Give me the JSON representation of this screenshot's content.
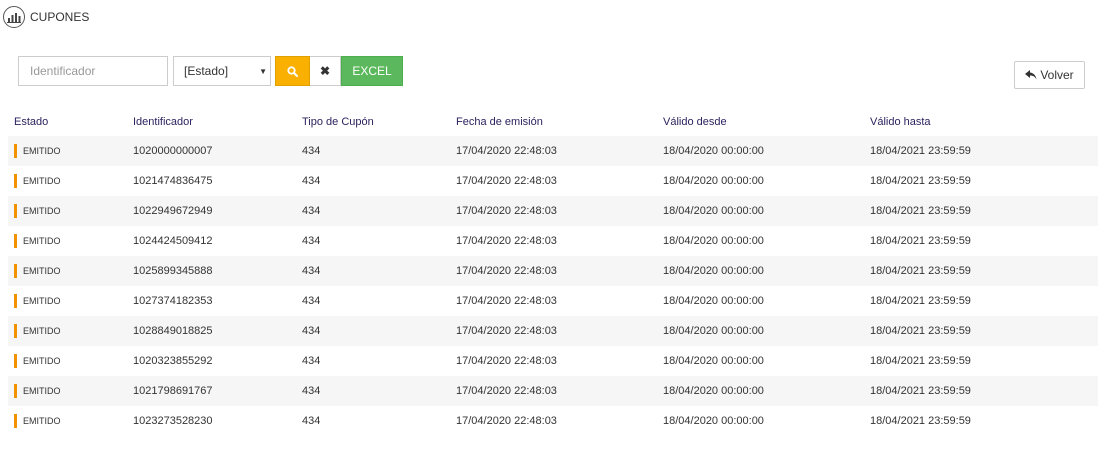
{
  "header": {
    "title": "CUPONES",
    "icon": "bar-chart-icon"
  },
  "filters": {
    "identifier_placeholder": "Identificador",
    "identifier_value": "",
    "state_selected": "[Estado]",
    "search_icon": "search-icon",
    "clear_icon": "close-icon",
    "excel_label": "EXCEL"
  },
  "back_button": {
    "label": "Volver",
    "icon": "reply-arrow-icon"
  },
  "colors": {
    "accent_orange": "#f9b000",
    "excel_green": "#5cb85c",
    "state_bar": "#f39200",
    "header_text": "#2a1f5c"
  },
  "table": {
    "columns": [
      "Estado",
      "Identificador",
      "Tipo de Cupón",
      "Fecha de emisión",
      "Válido desde",
      "Válido hasta"
    ],
    "rows": [
      {
        "estado": "EMITIDO",
        "identificador": "1020000000007",
        "tipo": "434",
        "emision": "17/04/2020 22:48:03",
        "desde": "18/04/2020 00:00:00",
        "hasta": "18/04/2021 23:59:59"
      },
      {
        "estado": "EMITIDO",
        "identificador": "1021474836475",
        "tipo": "434",
        "emision": "17/04/2020 22:48:03",
        "desde": "18/04/2020 00:00:00",
        "hasta": "18/04/2021 23:59:59"
      },
      {
        "estado": "EMITIDO",
        "identificador": "1022949672949",
        "tipo": "434",
        "emision": "17/04/2020 22:48:03",
        "desde": "18/04/2020 00:00:00",
        "hasta": "18/04/2021 23:59:59"
      },
      {
        "estado": "EMITIDO",
        "identificador": "1024424509412",
        "tipo": "434",
        "emision": "17/04/2020 22:48:03",
        "desde": "18/04/2020 00:00:00",
        "hasta": "18/04/2021 23:59:59"
      },
      {
        "estado": "EMITIDO",
        "identificador": "1025899345888",
        "tipo": "434",
        "emision": "17/04/2020 22:48:03",
        "desde": "18/04/2020 00:00:00",
        "hasta": "18/04/2021 23:59:59"
      },
      {
        "estado": "EMITIDO",
        "identificador": "1027374182353",
        "tipo": "434",
        "emision": "17/04/2020 22:48:03",
        "desde": "18/04/2020 00:00:00",
        "hasta": "18/04/2021 23:59:59"
      },
      {
        "estado": "EMITIDO",
        "identificador": "1028849018825",
        "tipo": "434",
        "emision": "17/04/2020 22:48:03",
        "desde": "18/04/2020 00:00:00",
        "hasta": "18/04/2021 23:59:59"
      },
      {
        "estado": "EMITIDO",
        "identificador": "1020323855292",
        "tipo": "434",
        "emision": "17/04/2020 22:48:03",
        "desde": "18/04/2020 00:00:00",
        "hasta": "18/04/2021 23:59:59"
      },
      {
        "estado": "EMITIDO",
        "identificador": "1021798691767",
        "tipo": "434",
        "emision": "17/04/2020 22:48:03",
        "desde": "18/04/2020 00:00:00",
        "hasta": "18/04/2021 23:59:59"
      },
      {
        "estado": "EMITIDO",
        "identificador": "1023273528230",
        "tipo": "434",
        "emision": "17/04/2020 22:48:03",
        "desde": "18/04/2020 00:00:00",
        "hasta": "18/04/2021 23:59:59"
      }
    ]
  }
}
